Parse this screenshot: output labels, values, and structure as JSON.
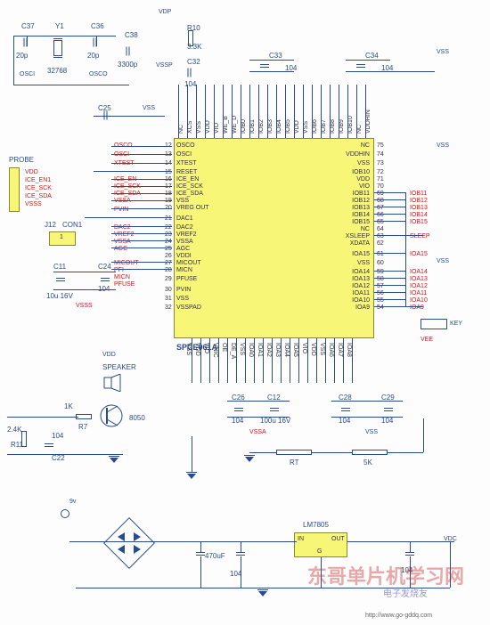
{
  "mcu": {
    "part": "SPCE061A",
    "left_pins": {
      "p12": "OSCO",
      "p13": "OSCI",
      "p14": "XTEST",
      "p15": "RESET",
      "p16": "ICE_EN",
      "p17": "ICE_SCK",
      "p18": "ICE_SDA",
      "p19": "VSS",
      "p20": "VREG OUT",
      "p21": "DAC1",
      "p22": "DAC2",
      "p23": "VREF2",
      "p24": "VSSA",
      "p25": "AGC",
      "p26": "VDDI",
      "p27": "MICOUT",
      "p28": "MICN",
      "p29": "PFUSE",
      "p30": "PVIN",
      "p31": "VSS",
      "p32": "VSSPAD"
    },
    "right_pins": {
      "p75": "NC",
      "p74": "VDDHIN",
      "p73": "VSS",
      "p72": "IOB10",
      "p71": "VDD",
      "p70": "VIO",
      "p69": "IOB11",
      "p68": "IOB12",
      "p67": "IOB13",
      "p66": "IOB14",
      "p65": "IOB15",
      "p64": "NC",
      "p63": "XSLEEP",
      "p62": "XDATA",
      "p61": "IOA15",
      "p60": "VSS",
      "p59": "IOA14",
      "p58": "IOA13",
      "p57": "IOA12",
      "p56": "IOA11",
      "p55": "IOA10",
      "p54": "IOA9"
    },
    "right_nets": {
      "IOB11": "IOB11",
      "IOB12": "IOB12",
      "IOB13": "IOB13",
      "IOB14": "IOB14",
      "IOB15": "IOB15",
      "XSLEEP": "SLEEP",
      "IOA15": "IOA15",
      "IOA14": "IOA14",
      "IOA13": "IOA13",
      "IOA12": "IOA12",
      "IOA11": "IOA11",
      "IOA10": "IOA10",
      "IOA9": "IOA9",
      "key": "KEY"
    },
    "top_pins": [
      "NC",
      "XCS",
      "VSS",
      "VDD",
      "VIO",
      "WE_B",
      "WE_D",
      "IOB0",
      "IOB1",
      "IOB2",
      "IOB3",
      "IOB4",
      "IOB5",
      "VDD",
      "VSS",
      "IOB6",
      "IOB7",
      "IOB8",
      "IOB9",
      "IOB10",
      "NC",
      "VDDHIN"
    ],
    "bot_pins": [
      "VSS",
      "VDD",
      "VIO",
      "VNIC",
      "OE",
      "DE_A",
      "VSS",
      "IOA0",
      "IOA1",
      "IOA2",
      "IOA3",
      "IOA4",
      "IOA5",
      "VIO",
      "VDD",
      "VSS",
      "IOA6",
      "IOA7",
      "IOA8"
    ]
  },
  "left_nets": {
    "osco": "OSCO",
    "osci": "OSCI",
    "xtest": "XTEST",
    "ice_en": "ICE_EN",
    "ice_sck": "ICE_SCK",
    "ice_sda": "ICE_SDA",
    "vssa": "VSSA",
    "pvin": "PVIN",
    "dac2": "DAC2",
    "vref2": "VREF2",
    "vssa2": "VSSA",
    "agc": "AGC",
    "micout": "MICOUT",
    "pfi": "PFI",
    "micn": "MICN",
    "pfuse": "PFUSE"
  },
  "probe": {
    "ref": "PROBE",
    "nets": {
      "vdd": "VDD",
      "ice_en1": "ICE_EN1",
      "ice_sck": "ICE_SCK",
      "ice_sda": "ICE_SDA",
      "vsss": "VSSS"
    }
  },
  "crystal": {
    "ref": "Y1",
    "val": "32768"
  },
  "caps": {
    "c37": {
      "ref": "C37",
      "val": "20p"
    },
    "c36": {
      "ref": "C36",
      "val": "20p"
    },
    "c38": {
      "ref": "C38",
      "val": "3300p"
    },
    "c33": {
      "ref": "C33",
      "val": "104"
    },
    "c34": {
      "ref": "C34",
      "val": "104"
    },
    "c32": {
      "ref": "C32",
      "val": "104"
    },
    "c25": {
      "ref": "C25",
      "val": ""
    },
    "c11": {
      "ref": "C11",
      "val": "10u 16V"
    },
    "c24": {
      "ref": "C24",
      "val": "104"
    },
    "c22": {
      "ref": "C22",
      "val": "104"
    },
    "c26": {
      "ref": "C26",
      "val": "104"
    },
    "c12": {
      "ref": "C12",
      "val": "100u 16V"
    },
    "c28": {
      "ref": "C28",
      "val": "104"
    },
    "c29": {
      "ref": "C29",
      "val": "104"
    },
    "cpwr1": {
      "val": "470uF"
    },
    "cpwr2": {
      "val": "104"
    },
    "cpwr3": {
      "val": "104"
    }
  },
  "resistors": {
    "r10": {
      "ref": "R10",
      "val": "3.3K"
    },
    "r7": {
      "ref": "R7",
      "val": "1K"
    },
    "r11": {
      "ref": "R11",
      "val": "2.4K"
    },
    "rt": {
      "ref": "RT",
      "val": ""
    },
    "r5k": {
      "ref": "",
      "val": "5K"
    }
  },
  "conn": {
    "j12": {
      "ref": "J12",
      "type": "CON1"
    }
  },
  "speaker": {
    "ref": "SPEAKER",
    "q": "8050"
  },
  "power": {
    "vdp": "VDP",
    "vss": "VSS",
    "vssp": "VSSP",
    "vsss": "VSSS",
    "vssa": "VSSA",
    "vin": "9v",
    "reg": "LM7805",
    "pin_in": "IN",
    "pin_out": "OUT",
    "pin_gnd": "G",
    "vdc": "VDC",
    "osci": "OSCI",
    "osco": "OSCO",
    "vee": "VEE"
  },
  "watermark": {
    "big": "东哥单片机学习网",
    "small": "电子发烧友",
    "url": "http://www.go-gddq.com"
  }
}
